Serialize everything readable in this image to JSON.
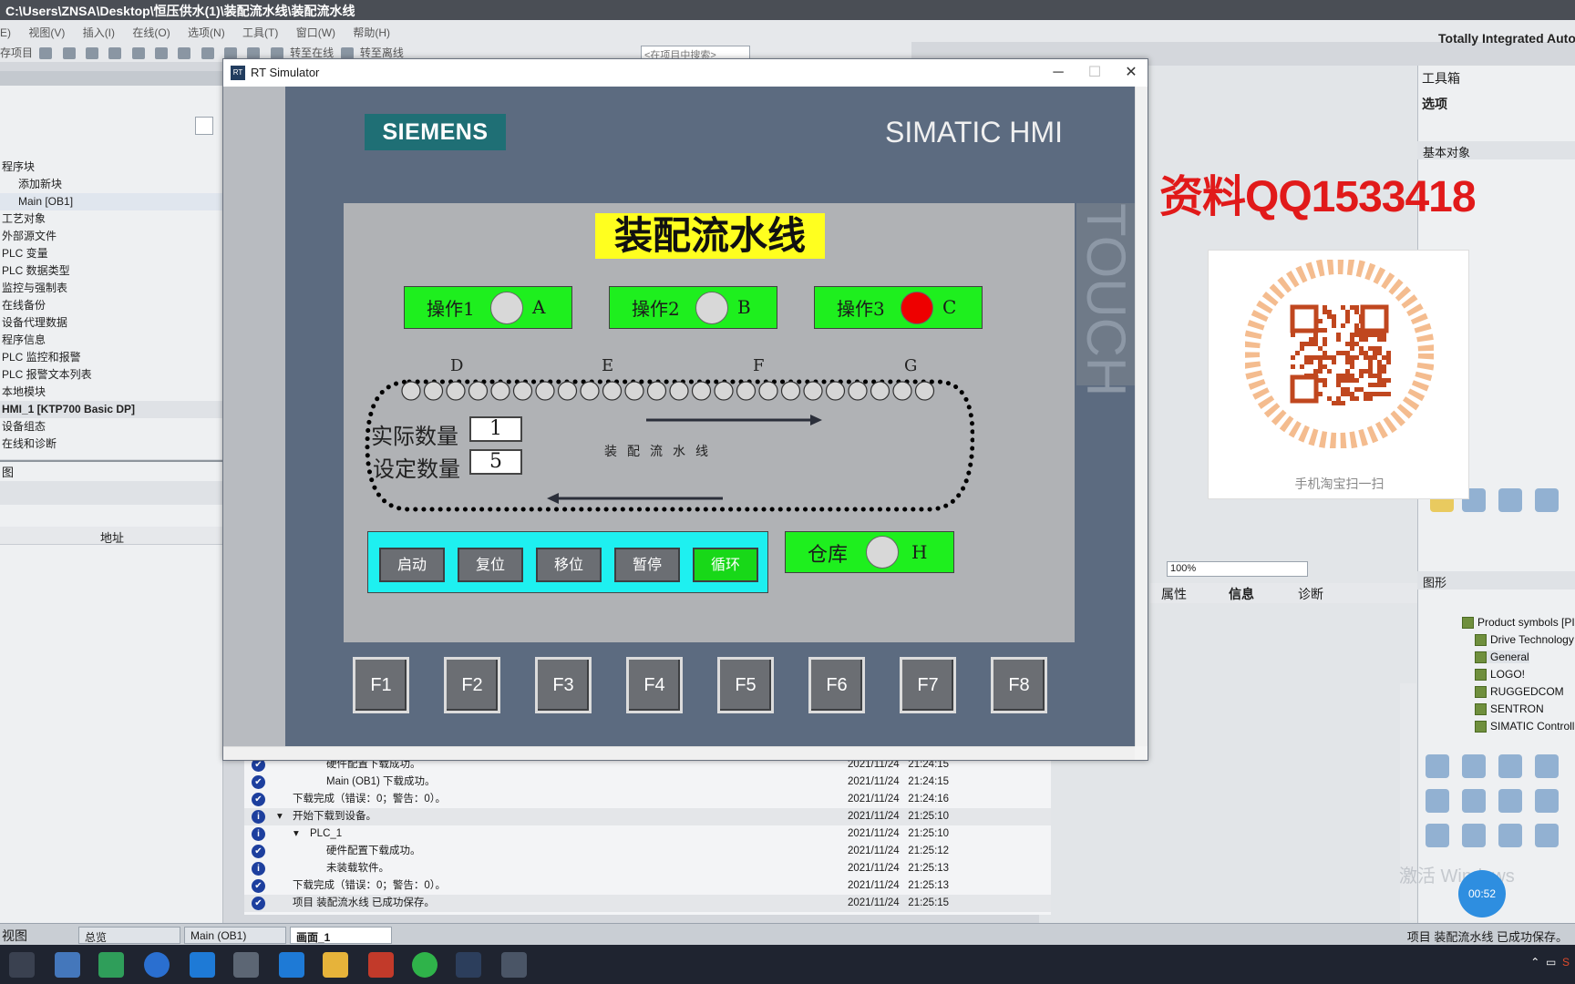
{
  "tia": {
    "title": "C:\\Users\\ZNSA\\Desktop\\恒压供水(1)\\装配流水线\\装配流水线",
    "menu": [
      "E)",
      "视图(V)",
      "插入(I)",
      "在线(O)",
      "选项(N)",
      "工具(T)",
      "窗口(W)",
      "帮助(H)"
    ],
    "brand": "Totally Integrated Automation",
    "toolbar": {
      "save_label": "存项目",
      "go_online": "转至在线",
      "go_offline": "转至离线"
    },
    "search_placeholder": "<在项目中搜索>",
    "tree": [
      "程序块",
      "添加新块",
      "Main [OB1]",
      "工艺对象",
      "外部源文件",
      "PLC 变量",
      "PLC 数据类型",
      "监控与强制表",
      "在线备份",
      "设备代理数据",
      "程序信息",
      "PLC 监控和报警",
      "PLC 报警文本列表",
      "本地模块",
      "HMI_1 [KTP700 Basic DP]",
      "设备组态",
      "在线和诊断"
    ],
    "lower_panel_title": "图",
    "lower_panel_col": "地址"
  },
  "right": {
    "toolbox_title": "工具箱",
    "options_title": "选项",
    "basic_objects": "基本对象",
    "graphics": "图形",
    "library": [
      "Product symbols [PI",
      "Drive Technology",
      "General",
      "LOGO!",
      "RUGGEDCOM",
      "SENTRON",
      "SIMATIC Controlle"
    ],
    "zoom": "100%",
    "info_tabs": [
      "属性",
      "信息",
      "诊断"
    ]
  },
  "log": [
    {
      "icon": "check",
      "msg": "硬件配置下载成功。",
      "date": "2021/11/24",
      "time": "21:24:15",
      "indent": 2
    },
    {
      "icon": "check",
      "msg": "Main (OB1) 下载成功。",
      "date": "2021/11/24",
      "time": "21:24:15",
      "indent": 2
    },
    {
      "icon": "check",
      "msg": "下载完成（错误：0；警告：0）。",
      "date": "2021/11/24",
      "time": "21:24:16",
      "indent": 0
    },
    {
      "icon": "info",
      "msg": "开始下载到设备。",
      "date": "2021/11/24",
      "time": "21:25:10",
      "indent": 0,
      "expand": true
    },
    {
      "icon": "info",
      "msg": "PLC_1",
      "date": "2021/11/24",
      "time": "21:25:10",
      "indent": 1,
      "expand": true
    },
    {
      "icon": "check",
      "msg": "硬件配置下载成功。",
      "date": "2021/11/24",
      "time": "21:25:12",
      "indent": 2
    },
    {
      "icon": "info",
      "msg": "未装载软件。",
      "date": "2021/11/24",
      "time": "21:25:13",
      "indent": 2
    },
    {
      "icon": "check",
      "msg": "下载完成（错误：0；警告：0）。",
      "date": "2021/11/24",
      "time": "21:25:13",
      "indent": 0
    },
    {
      "icon": "check",
      "msg": "项目 装配流水线 已成功保存。",
      "date": "2021/11/24",
      "time": "21:25:15",
      "indent": 0
    }
  ],
  "bottom": {
    "portal_view": "视图",
    "tabs": [
      "总览",
      "Main (OB1)",
      "画面_1"
    ],
    "status": "项目 装配流水线 已成功保存。"
  },
  "rt": {
    "title": "RT Simulator",
    "brand": "SIEMENS",
    "product": "SIMATIC HMI",
    "touch": "TOUCH",
    "hmi_title": "装配流水线",
    "operations": [
      {
        "label": "操作1",
        "channel": "A",
        "lamp_on": false
      },
      {
        "label": "操作2",
        "channel": "B",
        "lamp_on": false
      },
      {
        "label": "操作3",
        "channel": "C",
        "lamp_on": true
      }
    ],
    "conveyor_stations": [
      "D",
      "E",
      "F",
      "G"
    ],
    "actual_qty_label": "实际数量",
    "actual_qty": "1",
    "set_qty_label": "设定数量",
    "set_qty": "5",
    "line_label": "装配流水线",
    "buttons": [
      "启动",
      "复位",
      "移位",
      "暂停",
      "循环"
    ],
    "warehouse": {
      "label": "仓库",
      "channel": "H"
    },
    "fkeys": [
      "F1",
      "F2",
      "F3",
      "F4",
      "F5",
      "F6",
      "F7",
      "F8"
    ]
  },
  "overlay": {
    "watermark": "资料QQ1533418",
    "qr_caption": "手机淘宝扫一扫",
    "windows_watermark": "激活 Windows",
    "timer": "00:52"
  },
  "colors": {
    "accent_green": "#1eef1e",
    "lamp_red": "#ee0000",
    "hmi_title_bg": "#ffff1f",
    "ctrl_cyan": "#1ef0f0",
    "siemens_teal": "#1f6f75"
  }
}
